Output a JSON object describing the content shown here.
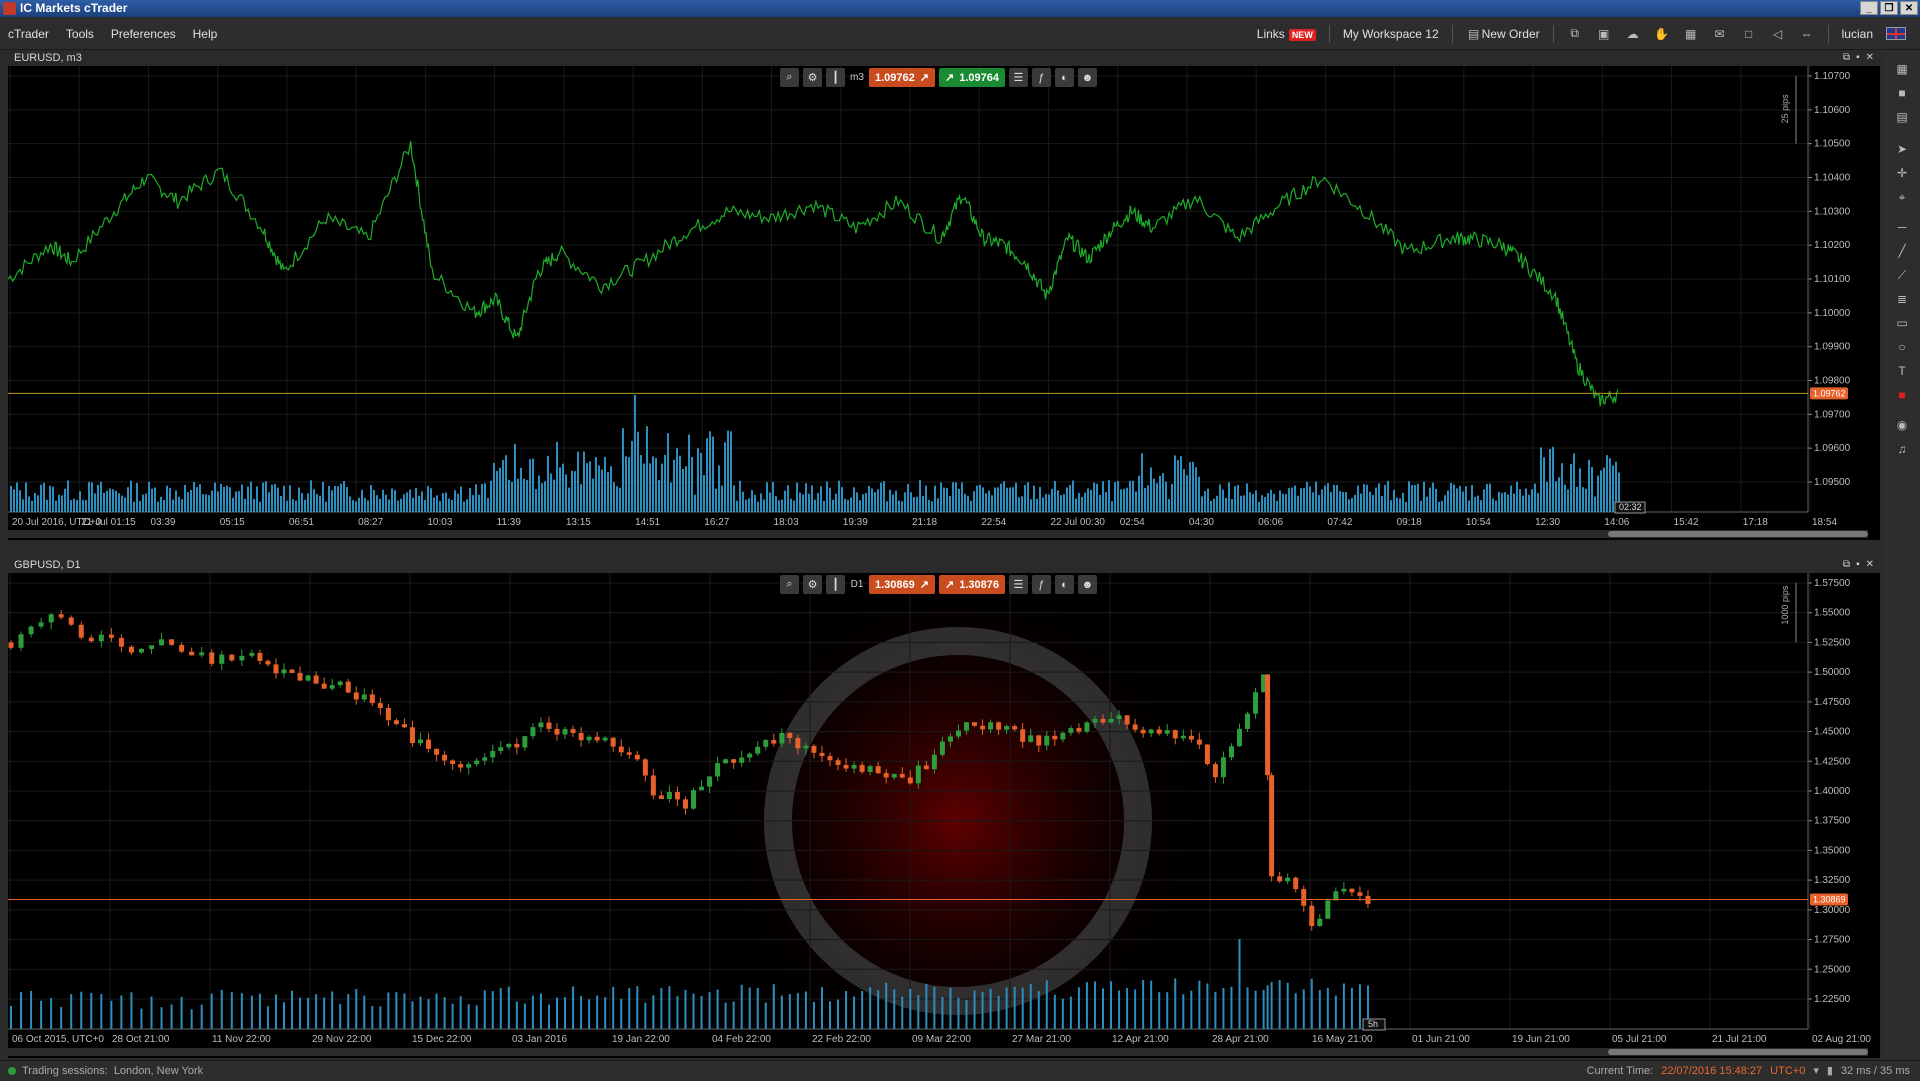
{
  "app": {
    "title": "IC Markets cTrader",
    "window_buttons": [
      "_",
      "❐",
      "✕"
    ]
  },
  "menu": {
    "items": [
      "cTrader",
      "Tools",
      "Preferences",
      "Help"
    ]
  },
  "toolbar": {
    "links": "Links",
    "new_badge": "NEW",
    "workspace": "My Workspace 12",
    "new_order": "New Order",
    "user": "lucian"
  },
  "charts": [
    {
      "symbol": "EURUSD, m3",
      "timeframe": "m3",
      "sell_price": "1.09762",
      "buy_price": "1.09764",
      "current_price_label": "1.09762",
      "countdown": "02:32",
      "pips_label": "25 pips",
      "colors": {
        "line": "#1fae2a",
        "volume": "#2b8fbf",
        "price_line": "#b49a1e",
        "price_tag": "#e8612a"
      },
      "y_ticks": [
        "1.10700",
        "1.10600",
        "1.10500",
        "1.10400",
        "1.10300",
        "1.10200",
        "1.10100",
        "1.10000",
        "1.09900",
        "1.09800",
        "1.09700",
        "1.09600",
        "1.09500"
      ],
      "x_ticks": [
        "20 Jul 2016, UTC+0",
        "21 Jul 01:15",
        "03:39",
        "05:15",
        "06:51",
        "08:27",
        "10:03",
        "11:39",
        "13:15",
        "14:51",
        "16:27",
        "18:03",
        "19:39",
        "21:18",
        "22:54",
        "22 Jul 00:30",
        "02:54",
        "04:30",
        "06:06",
        "07:42",
        "09:18",
        "10:54",
        "12:30",
        "14:06",
        "15:42",
        "17:18",
        "18:54"
      ]
    },
    {
      "symbol": "GBPUSD, D1",
      "timeframe": "D1",
      "sell_price": "1.30869",
      "buy_price": "1.30876",
      "current_price_label": "1.30869",
      "countdown": "5h",
      "pips_label": "1000 pips",
      "colors": {
        "up": "#2e9e3c",
        "down": "#e8612a",
        "volume": "#2b8fbf",
        "price_line": "#e8612a",
        "price_tag": "#e8612a"
      },
      "y_ticks": [
        "1.57500",
        "1.55000",
        "1.52500",
        "1.50000",
        "1.47500",
        "1.45000",
        "1.42500",
        "1.40000",
        "1.37500",
        "1.35000",
        "1.32500",
        "1.30000",
        "1.27500",
        "1.25000",
        "1.22500"
      ],
      "x_ticks": [
        "06 Oct 2015, UTC+0",
        "28 Oct 21:00",
        "11 Nov 22:00",
        "29 Nov 22:00",
        "15 Dec 22:00",
        "03 Jan 2016",
        "19 Jan 22:00",
        "04 Feb 22:00",
        "22 Feb 22:00",
        "09 Mar 22:00",
        "27 Mar 21:00",
        "12 Apr 21:00",
        "28 Apr 21:00",
        "16 May 21:00",
        "01 Jun 21:00",
        "19 Jun 21:00",
        "05 Jul 21:00",
        "21 Jul 21:00",
        "02 Aug 21:00"
      ]
    }
  ],
  "status": {
    "sessions_label": "Trading sessions:",
    "sessions": "London, New York",
    "current_time_label": "Current Time:",
    "current_time": "22/07/2016 15:48:27",
    "timezone": "UTC+0",
    "latency": "32 ms / 35 ms"
  }
}
